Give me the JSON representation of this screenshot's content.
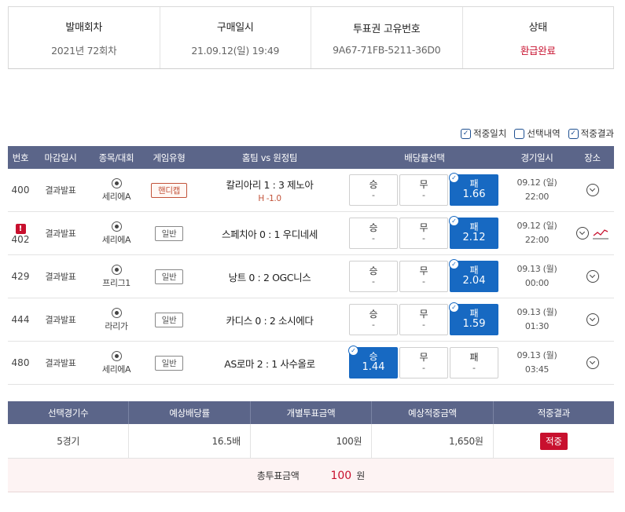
{
  "info": {
    "round_label": "발매회차",
    "round_value": "2021년 72회차",
    "purchase_label": "구매일시",
    "purchase_value": "21.09.12(일) 19:49",
    "ticket_label": "투표권 고유번호",
    "ticket_value": "9A67-71FB-5211-36D0",
    "status_label": "상태",
    "status_value": "환급완료"
  },
  "legend": {
    "match": "적중일치",
    "selected": "선택내역",
    "result": "적중결과"
  },
  "headers": {
    "no": "번호",
    "close": "마감일시",
    "sport": "종목/대회",
    "type": "게임유형",
    "match": "홈팀 vs 원정팀",
    "odds": "배당률선택",
    "date": "경기일시",
    "place": "장소"
  },
  "games": [
    {
      "no": "400",
      "warn": "",
      "close": "결과발표",
      "league": "세리에A",
      "type": "핸디캡",
      "handicap": true,
      "match": "칼리아리 1 : 3 제노아",
      "hline": "H -1.0",
      "win": {
        "l": "승",
        "o": "-"
      },
      "draw": {
        "l": "무",
        "o": "-"
      },
      "lose": {
        "l": "패",
        "o": "1.66"
      },
      "sel": "lose",
      "date1": "09.12 (일)",
      "date2": "22:00",
      "trend": false
    },
    {
      "no": "402",
      "warn": "!",
      "close": "결과발표",
      "league": "세리에A",
      "type": "일반",
      "handicap": false,
      "match": "스페치아 0 : 1 우디네세",
      "hline": "",
      "win": {
        "l": "승",
        "o": "-"
      },
      "draw": {
        "l": "무",
        "o": "-"
      },
      "lose": {
        "l": "패",
        "o": "2.12"
      },
      "sel": "lose",
      "date1": "09.12 (일)",
      "date2": "22:00",
      "trend": true
    },
    {
      "no": "429",
      "warn": "",
      "close": "결과발표",
      "league": "프리그1",
      "type": "일반",
      "handicap": false,
      "match": "낭트 0 : 2 OGC니스",
      "hline": "",
      "win": {
        "l": "승",
        "o": "-"
      },
      "draw": {
        "l": "무",
        "o": "-"
      },
      "lose": {
        "l": "패",
        "o": "2.04"
      },
      "sel": "lose",
      "date1": "09.13 (월)",
      "date2": "00:00",
      "trend": false
    },
    {
      "no": "444",
      "warn": "",
      "close": "결과발표",
      "league": "라리가",
      "type": "일반",
      "handicap": false,
      "match": "카디스 0 : 2 소시에다",
      "hline": "",
      "win": {
        "l": "승",
        "o": "-"
      },
      "draw": {
        "l": "무",
        "o": "-"
      },
      "lose": {
        "l": "패",
        "o": "1.59"
      },
      "sel": "lose",
      "date1": "09.13 (월)",
      "date2": "01:30",
      "trend": false
    },
    {
      "no": "480",
      "warn": "",
      "close": "결과발표",
      "league": "세리에A",
      "type": "일반",
      "handicap": false,
      "match": "AS로마 2 : 1 사수올로",
      "hline": "",
      "win": {
        "l": "승",
        "o": "1.44"
      },
      "draw": {
        "l": "무",
        "o": "-"
      },
      "lose": {
        "l": "패",
        "o": "-"
      },
      "sel": "win",
      "date1": "09.13 (월)",
      "date2": "03:45",
      "trend": false
    }
  ],
  "summary": {
    "h_count": "선택경기수",
    "h_odds": "예상배당률",
    "h_amount": "개별투표금액",
    "h_expected": "예상적중금액",
    "h_result": "적중결과",
    "count": "5경기",
    "odds": "16.5배",
    "amount": "100원",
    "expected": "1,650원",
    "result": "적중",
    "total_label": "총투표금액",
    "total_value": "100",
    "total_unit": "원"
  },
  "colors": {
    "header_bg": "#5b6589",
    "selected_odds": "#1769c2",
    "accent_red": "#c8102e"
  }
}
